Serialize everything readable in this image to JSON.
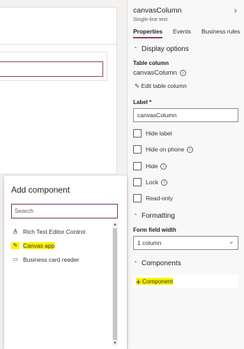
{
  "panel": {
    "title": "canvasColumn",
    "subtitle": "Single-line text",
    "tabs": [
      "Properties",
      "Events",
      "Business rules"
    ],
    "display_options": {
      "heading": "Display options",
      "table_column_label": "Table column",
      "table_column_value": "canvasColumn",
      "edit_link": "Edit table column",
      "label_caption": "Label *",
      "label_value": "canvasColumn",
      "checkboxes": [
        "Hide label",
        "Hide on phone",
        "Hide",
        "Lock",
        "Read-only"
      ]
    },
    "formatting": {
      "heading": "Formatting",
      "width_label": "Form field width",
      "width_value": "1 column"
    },
    "components": {
      "heading": "Components",
      "add_label": "Component"
    }
  },
  "flyout": {
    "title": "Add component",
    "search_placeholder": "Search",
    "items": [
      "Rich Text Editor Control",
      "Canvas app",
      "Business card reader"
    ]
  },
  "colors": {
    "accent": "#8a3a6e",
    "highlight": "#fff200"
  }
}
